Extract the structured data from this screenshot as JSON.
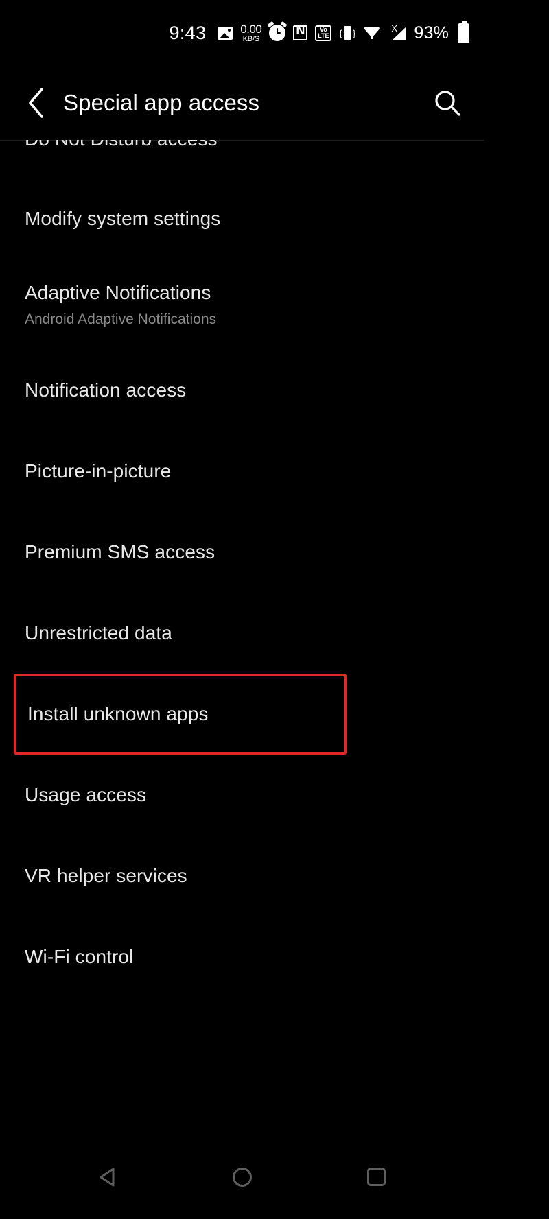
{
  "status_bar": {
    "time": "9:43",
    "network_speed_value": "0.00",
    "network_speed_unit": "KB/S",
    "volte_top": "Vo",
    "volte_bottom": "LTE",
    "nfc_letter": "N",
    "signal_no_service_mark": "X",
    "battery_percent": "93%",
    "icons": [
      "gallery-icon",
      "network-speed-icon",
      "alarm-icon",
      "nfc-icon",
      "volte-icon",
      "vibrate-icon",
      "wifi-icon",
      "cellular-signal-icon",
      "battery-icon"
    ]
  },
  "app_bar": {
    "back_label": "Back",
    "title": "Special app access",
    "search_label": "Search"
  },
  "list": {
    "items": [
      {
        "title": "Do Not Disturb access",
        "subtitle": "",
        "state": "clipped",
        "highlighted": false
      },
      {
        "title": "Modify system settings",
        "subtitle": "",
        "state": "single",
        "highlighted": false
      },
      {
        "title": "Adaptive Notifications",
        "subtitle": "Android Adaptive Notifications",
        "state": "double",
        "highlighted": false
      },
      {
        "title": "Notification access",
        "subtitle": "",
        "state": "single",
        "highlighted": false
      },
      {
        "title": "Picture-in-picture",
        "subtitle": "",
        "state": "single",
        "highlighted": false
      },
      {
        "title": "Premium SMS access",
        "subtitle": "",
        "state": "single",
        "highlighted": false
      },
      {
        "title": "Unrestricted data",
        "subtitle": "",
        "state": "single",
        "highlighted": false
      },
      {
        "title": "Install unknown apps",
        "subtitle": "",
        "state": "single",
        "highlighted": true
      },
      {
        "title": "Usage access",
        "subtitle": "",
        "state": "single",
        "highlighted": false
      },
      {
        "title": "VR helper services",
        "subtitle": "",
        "state": "single",
        "highlighted": false
      },
      {
        "title": "Wi-Fi control",
        "subtitle": "",
        "state": "single",
        "highlighted": false
      }
    ]
  },
  "nav_bar": {
    "back_label": "Back",
    "home_label": "Home",
    "recents_label": "Recents"
  },
  "colors": {
    "background": "#000000",
    "primary_text": "#e8e8e8",
    "secondary_text": "#8a8a8a",
    "highlight_border": "#e02828",
    "nav_icon": "#5e5e5e",
    "divider": "#1f1f1f"
  }
}
